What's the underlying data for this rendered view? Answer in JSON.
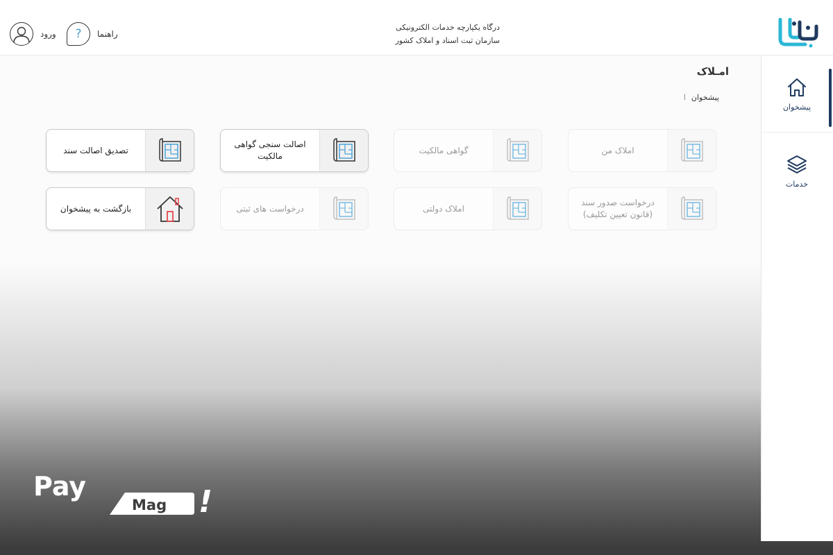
{
  "header": {
    "title_line1": "درگاه یکپارچه خدمات الکترونیکی",
    "title_line2": "سازمان ثبت اسناد و املاک کشور",
    "login_label": "ورود",
    "help_label": "راهنما",
    "help_icon": "?",
    "logo_text": "ثبت من"
  },
  "sidebar": {
    "items": [
      {
        "label": "پیشخوان",
        "icon": "home-icon",
        "active": true
      },
      {
        "label": "خدمات",
        "icon": "layers-icon",
        "active": false
      }
    ]
  },
  "page": {
    "title": "امـلاک",
    "breadcrumb": "پیشخوان",
    "breadcrumb_sep": "ا"
  },
  "cards": [
    {
      "label": "املاک من",
      "icon": "blueprint-icon",
      "enabled": false
    },
    {
      "label": "گواهی مالکیت",
      "icon": "blueprint-icon",
      "enabled": false
    },
    {
      "label": "اصالت سنجی گواهی مالکیت",
      "icon": "blueprint-icon",
      "enabled": true
    },
    {
      "label": "تصدیق اصالت سند",
      "icon": "blueprint-icon",
      "enabled": true
    },
    {
      "label": "درخواست صدور سند (قانون تعیین تکلیف)",
      "icon": "blueprint-icon",
      "enabled": false
    },
    {
      "label": "املاک دولتی",
      "icon": "blueprint-icon",
      "enabled": false
    },
    {
      "label": "درخواست های ثبتی",
      "icon": "blueprint-icon",
      "enabled": false
    },
    {
      "label": "بازگشت به پیشخوان",
      "icon": "house-icon",
      "enabled": true
    }
  ],
  "colors": {
    "accent": "#1e3a5f",
    "logo_cyan": "#2bb7d6",
    "logo_navy": "#1e3a5f",
    "blueprint_blue": "#4aa3d8",
    "house_red": "#e5484d"
  },
  "watermark": {
    "text_pay": "Pay",
    "text_mag": "Mag",
    "text_bang": "!"
  }
}
